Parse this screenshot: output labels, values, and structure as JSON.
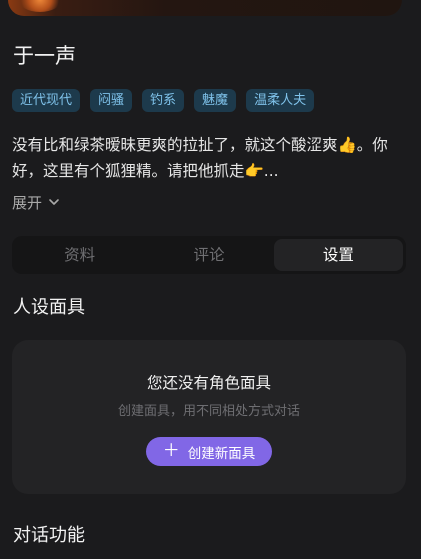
{
  "character": {
    "name": "于一声",
    "tags": [
      "近代现代",
      "闷骚",
      "钓系",
      "魅魔",
      "温柔人夫"
    ],
    "description": "没有比和绿茶暧昧更爽的拉扯了，就这个酸涩爽👍。你好，这里有个狐狸精。请把他抓走👉...",
    "expand_label": "展开"
  },
  "tabs": [
    {
      "label": "资料",
      "active": false
    },
    {
      "label": "评论",
      "active": false
    },
    {
      "label": "设置",
      "active": true
    }
  ],
  "persona_mask": {
    "section_title": "人设面具",
    "empty_title": "您还没有角色面具",
    "empty_subtitle": "创建面具，用不同相处方式对话",
    "create_button_label": "创建新面具",
    "create_button_icon": "plus-icon"
  },
  "chat_features": {
    "section_title": "对话功能"
  },
  "colors": {
    "background": "#1b1b1d",
    "tag_background": "#1d3a4c",
    "tag_text": "#7fc2ea",
    "accent": "#8167e6"
  }
}
